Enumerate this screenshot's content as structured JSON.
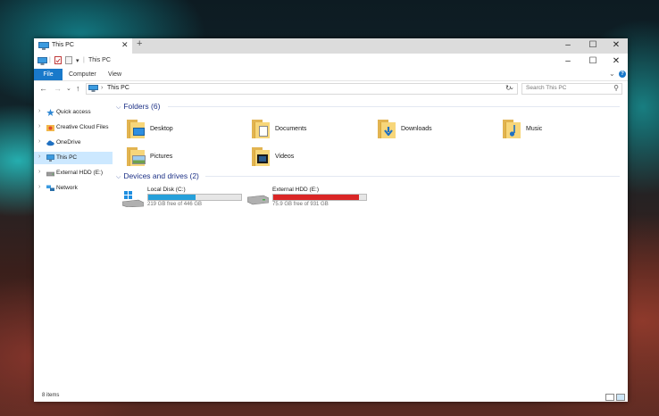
{
  "window": {
    "tab_title": "This PC",
    "title": "This PC"
  },
  "ribbon": {
    "tabs": [
      "File",
      "Computer",
      "View"
    ]
  },
  "address": {
    "path": "This PC",
    "search_placeholder": "Search This PC"
  },
  "sidebar": {
    "items": [
      {
        "label": "Quick access",
        "icon": "star-pin-icon"
      },
      {
        "label": "Creative Cloud Files",
        "icon": "creative-cloud-icon"
      },
      {
        "label": "OneDrive",
        "icon": "onedrive-cloud-icon"
      },
      {
        "label": "This PC",
        "icon": "computer-icon",
        "selected": true
      },
      {
        "label": "External HDD (E:)",
        "icon": "drive-icon"
      },
      {
        "label": "Network",
        "icon": "network-icon"
      }
    ]
  },
  "folders": {
    "header": "Folders (6)",
    "items": [
      {
        "label": "Desktop",
        "icon": "desktop-folder-icon"
      },
      {
        "label": "Documents",
        "icon": "documents-folder-icon"
      },
      {
        "label": "Downloads",
        "icon": "downloads-folder-icon"
      },
      {
        "label": "Music",
        "icon": "music-folder-icon"
      },
      {
        "label": "Pictures",
        "icon": "pictures-folder-icon"
      },
      {
        "label": "Videos",
        "icon": "videos-folder-icon"
      }
    ]
  },
  "drives": {
    "header": "Devices and drives (2)",
    "items": [
      {
        "name": "Local Disk (C:)",
        "free": "219 GB free of 446 GB",
        "used_fraction": 0.51,
        "bar_color": "#26a0da",
        "icon": "windows-drive-icon"
      },
      {
        "name": "External HDD (E:)",
        "free": "75.9 GB free of 931 GB",
        "used_fraction": 0.92,
        "bar_color": "#da2626",
        "icon": "hard-drive-icon"
      }
    ]
  },
  "status": {
    "count": "8 items"
  },
  "colors": {
    "accent": "#1979ca",
    "selection": "#cce8ff",
    "section_header": "#1e3287"
  }
}
